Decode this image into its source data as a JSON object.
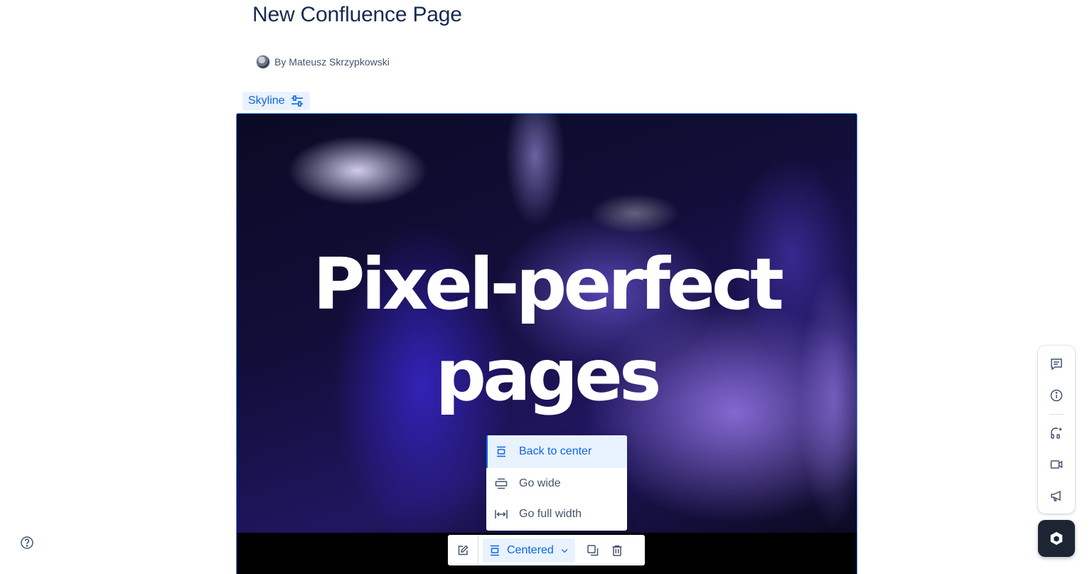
{
  "page": {
    "title": "New Confluence Page",
    "byline": "By Mateusz Skrzypkowski"
  },
  "macro": {
    "label": "Skyline",
    "settings_icon": "sliders-icon"
  },
  "hero": {
    "line1": "Pixel-perfect",
    "line2": "pages"
  },
  "width_menu": {
    "items": [
      {
        "label": "Back to center",
        "icon": "center-layout-icon",
        "selected": true
      },
      {
        "label": "Go wide",
        "icon": "wide-layout-icon",
        "selected": false
      },
      {
        "label": "Go full width",
        "icon": "full-width-icon",
        "selected": false
      }
    ]
  },
  "toolbar": {
    "edit_icon": "pencil-icon",
    "layout_label": "Centered",
    "layout_icon": "center-layout-icon",
    "copy_icon": "copy-icon",
    "delete_icon": "trash-icon"
  },
  "right_rail": {
    "items": [
      "comment-icon",
      "info-icon",
      "ai-icon",
      "video-icon",
      "megaphone-icon"
    ]
  },
  "colors": {
    "accent": "#0c66e4",
    "selected_bg": "#e9f2ff",
    "launcher_bg": "#1d2535"
  }
}
